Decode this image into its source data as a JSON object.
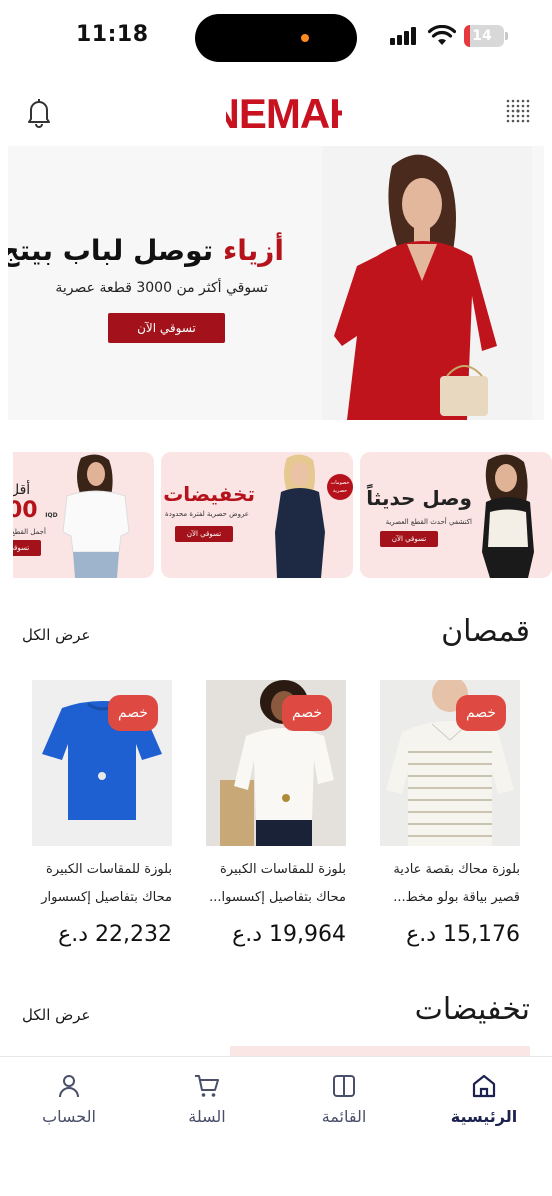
{
  "status_bar": {
    "time": "11:18",
    "battery": "14",
    "battery_level": 0.14
  },
  "header": {
    "logo": "NEMAH",
    "notifications_icon": "bell-icon",
    "menu_icon": "dots-grid-icon"
  },
  "hero": {
    "title_accent": "أزياء",
    "title_rest": " توصل لباب بيتج",
    "subtitle": "تسوقي أكثر من 3000 قطعة عصرية",
    "button": "تسوقي الآن"
  },
  "promos": [
    {
      "title": "وصل حديثاً",
      "subtitle": "اكتشفي أحدث القطع العصرية",
      "button": "تسوقي الآن"
    },
    {
      "title": "تخفيضات",
      "subtitle": "عروض حصرية لفترة محدودة",
      "button": "تسوقي الآن",
      "badge": "خصومات حصرية"
    },
    {
      "title": "أقل",
      "value": "00",
      "currency": "IQD",
      "subtitle": "أجمل القطع",
      "button": "تسوقي الآن"
    }
  ],
  "shirts_section": {
    "title": "قمصان",
    "view_all": "عرض الكل",
    "products": [
      {
        "badge": "خصم",
        "name": "بلوزة محاك بقصة عادية قصير بياقة بولو مخط...",
        "price": "15,176 د.ع"
      },
      {
        "badge": "خصم",
        "name": "بلوزة للمقاسات الكبيرة محاك بتفاصيل إكسسوا...",
        "price": "19,964 د.ع"
      },
      {
        "badge": "خصم",
        "name": "بلوزة للمقاسات الكبيرة محاك بتفاصيل إكسسوار",
        "price": "22,232 د.ع"
      }
    ]
  },
  "sales_section": {
    "title": "تخفيضات",
    "view_all": "عرض الكل"
  },
  "tab_bar": {
    "home": "الرئيسية",
    "menu": "القائمة",
    "cart": "السلة",
    "account": "الحساب",
    "active": "home"
  },
  "colors": {
    "brand_red": "#b5121b",
    "badge_red": "#de4a41",
    "promo_pink": "#fbe4e4",
    "nav_active": "#1c2250"
  }
}
